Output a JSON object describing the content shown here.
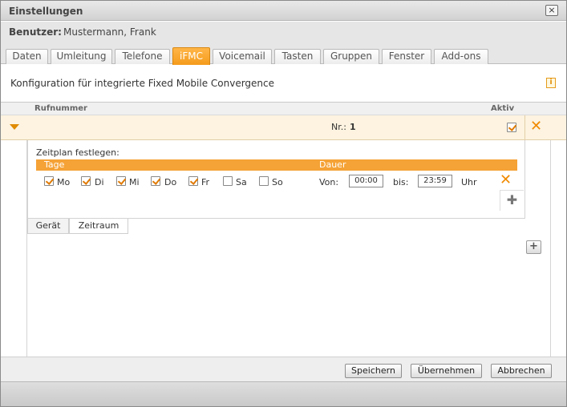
{
  "window": {
    "title": "Einstellungen",
    "close_glyph": "×"
  },
  "user": {
    "label": "Benutzer:",
    "name": "Mustermann, Frank"
  },
  "tabs": [
    {
      "label": "Daten",
      "active": false
    },
    {
      "label": "Umleitung",
      "active": false
    },
    {
      "label": "Telefone",
      "active": false
    },
    {
      "label": "iFMC",
      "active": true
    },
    {
      "label": "Voicemail",
      "active": false
    },
    {
      "label": "Tasten",
      "active": false
    },
    {
      "label": "Gruppen",
      "active": false
    },
    {
      "label": "Fenster",
      "active": false
    },
    {
      "label": "Add-ons",
      "active": false
    }
  ],
  "description": "Konfiguration für integrierte Fixed Mobile Convergence",
  "info_icon": "i",
  "grid": {
    "col_number": "Rufnummer",
    "col_active": "Aktiv",
    "row": {
      "nr_label": "Nr.:",
      "nr_value": "1",
      "active": true
    }
  },
  "schedule": {
    "label": "Zeitplan festlegen:",
    "col_days": "Tage",
    "col_duration": "Dauer",
    "days": [
      {
        "label": "Mo",
        "checked": true
      },
      {
        "label": "Di",
        "checked": true
      },
      {
        "label": "Mi",
        "checked": true
      },
      {
        "label": "Do",
        "checked": true
      },
      {
        "label": "Fr",
        "checked": true
      },
      {
        "label": "Sa",
        "checked": false
      },
      {
        "label": "So",
        "checked": false
      }
    ],
    "from_label": "Von:",
    "from_value": "00:00",
    "to_label": "bis:",
    "to_value": "23:59",
    "unit": "Uhr"
  },
  "subtabs": [
    {
      "label": "Gerät",
      "active": false
    },
    {
      "label": "Zeitraum",
      "active": true
    }
  ],
  "buttons": {
    "save": "Speichern",
    "apply": "Übernehmen",
    "cancel": "Abbrechen"
  },
  "colors": {
    "accent": "#f5a236",
    "row_highlight": "#fdf3e0",
    "delete": "#f08a00"
  }
}
